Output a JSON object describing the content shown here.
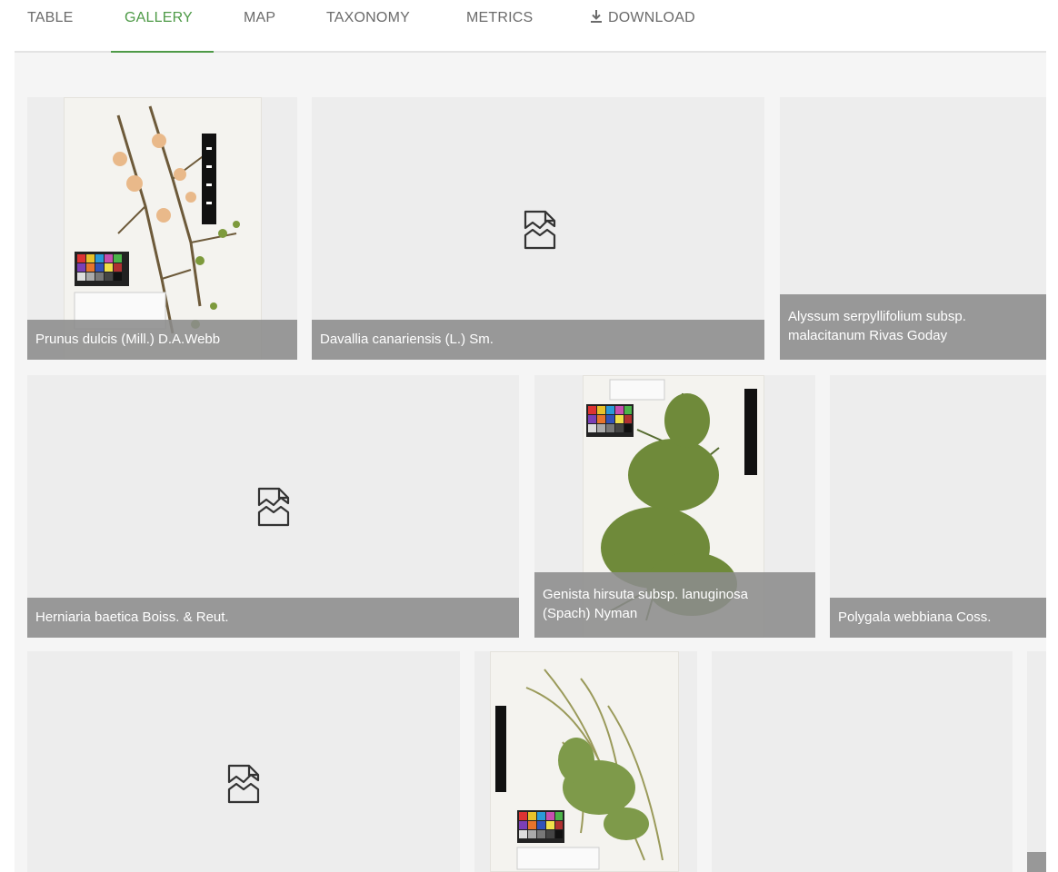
{
  "tabs": [
    {
      "label": "TABLE"
    },
    {
      "label": "GALLERY",
      "active": true
    },
    {
      "label": "MAP"
    },
    {
      "label": "TAXONOMY"
    },
    {
      "label": "METRICS"
    },
    {
      "label": "DOWNLOAD",
      "icon": "download-icon"
    }
  ],
  "colors": {
    "accent": "#4e9a47",
    "tab_text": "#6b6b6b",
    "tile_bg": "#ededed",
    "caption_bg": "#8c8c8c"
  },
  "gallery": {
    "items": [
      {
        "caption": "Prunus dulcis (Mill.) D.A.Webb",
        "has_image": true
      },
      {
        "caption": "Davallia canariensis (L.) Sm.",
        "has_image": false,
        "icon": "broken-image-icon"
      },
      {
        "caption_line1": "Alyssum serpyllifolium subsp.",
        "caption_line2": "malacitanum Rivas Goday",
        "has_image": false
      },
      {
        "caption": "Herniaria baetica Boiss. & Reut.",
        "has_image": false,
        "icon": "broken-image-icon"
      },
      {
        "caption_line1": "Genista hirsuta subsp. lanuginosa",
        "caption_line2": "(Spach) Nyman",
        "has_image": true
      },
      {
        "caption": "Polygala webbiana Coss.",
        "has_image": false
      },
      {
        "has_image": false,
        "icon": "broken-image-icon"
      },
      {
        "has_image": true
      },
      {
        "has_image": false
      },
      {
        "has_image": false
      }
    ]
  }
}
